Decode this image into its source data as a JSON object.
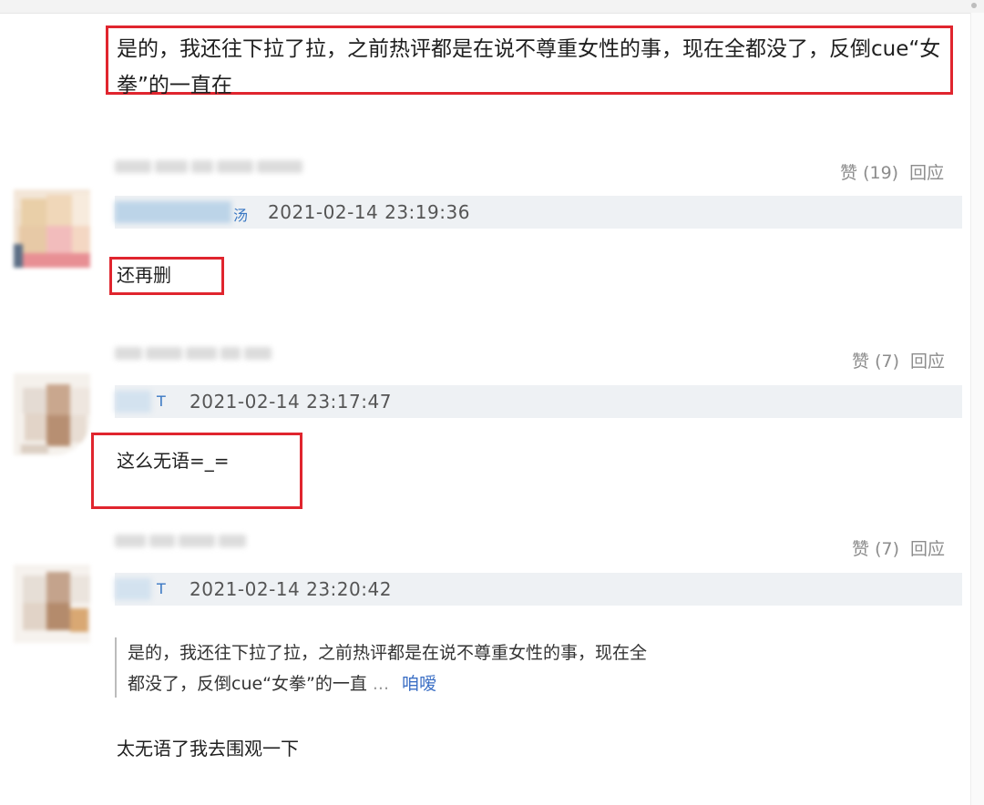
{
  "comment_main": {
    "text": "是的，我还往下拉了拉，之前热评都是在说不尊重女性的事，现在全都没了，反倒cue“女拳”的一直在"
  },
  "comments": [
    {
      "like_label": "赞",
      "like_count": "(19)",
      "reply_label": "回应",
      "time": "2021-02-14 23:19:36",
      "name_fragment": "汤",
      "body": "还再删"
    },
    {
      "like_label": "赞",
      "like_count": "(7)",
      "reply_label": "回应",
      "time": "2021-02-14 23:17:47",
      "name_fragment": "T",
      "body": "这么无语=_="
    },
    {
      "like_label": "赞",
      "like_count": "(7)",
      "reply_label": "回应",
      "time": "2021-02-14 23:20:42",
      "name_fragment": "T",
      "quote_line1": "是的，我还往下拉了拉，之前热评都是在说不尊重女性的事，现在全",
      "quote_line2": "都没了，反倒cue“女拳”的一直",
      "quote_ellipsis": "...",
      "quote_more": "咱嗳",
      "body": "太无语了我去围观一下"
    }
  ],
  "colors": {
    "highlight_box": "#e0252e",
    "link": "#3a6ec4",
    "meta_gray": "#8c8c8c",
    "namebar_bg": "#eef1f4"
  }
}
